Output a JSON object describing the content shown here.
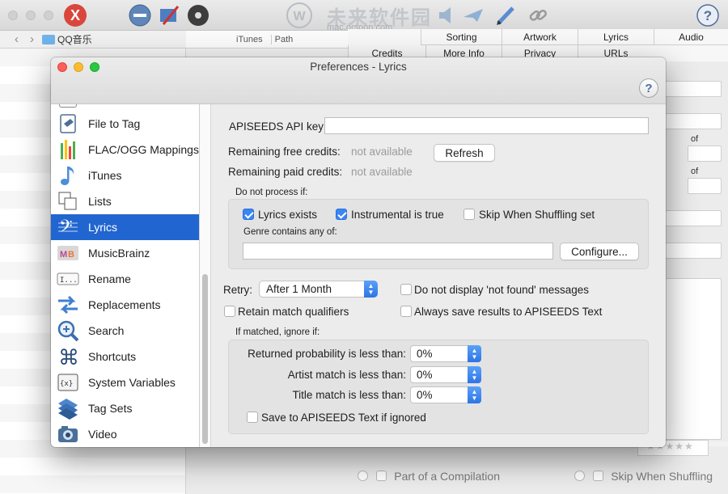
{
  "background": {
    "path_folder": "QQ音乐",
    "columns": [
      "iTunes",
      "Path"
    ],
    "tabs_row1": [
      "Sorting",
      "Artwork",
      "Lyrics",
      "Audio"
    ],
    "tabs_row2": [
      "Credits",
      "More Info",
      "Privacy",
      "URLs"
    ],
    "of_label_1": "of",
    "of_label_2": "of",
    "watermark_cn": "未来软件园",
    "watermark_url": "mac.orsoon.com",
    "bottom_compilation": "Part of a Compilation",
    "bottom_skip": "Skip When Shuffling",
    "rating_stars": "★★★★★"
  },
  "dialog": {
    "title": "Preferences - Lyrics",
    "help": "?"
  },
  "sidebar": {
    "items": [
      {
        "label": "File to Tag",
        "icon": "file-tag-icon"
      },
      {
        "label": "FLAC/OGG Mappings",
        "icon": "flac-ogg-icon"
      },
      {
        "label": "iTunes",
        "icon": "itunes-note-icon"
      },
      {
        "label": "Lists",
        "icon": "lists-icon"
      },
      {
        "label": "Lyrics",
        "icon": "lyrics-clef-icon",
        "selected": true
      },
      {
        "label": "MusicBrainz",
        "icon": "musicbrainz-icon"
      },
      {
        "label": "Rename",
        "icon": "rename-icon"
      },
      {
        "label": "Replacements",
        "icon": "replacements-icon"
      },
      {
        "label": "Search",
        "icon": "search-icon"
      },
      {
        "label": "Shortcuts",
        "icon": "command-key-icon"
      },
      {
        "label": "System Variables",
        "icon": "system-variables-icon"
      },
      {
        "label": "Tag Sets",
        "icon": "tag-sets-icon"
      },
      {
        "label": "Video",
        "icon": "video-camera-icon"
      }
    ]
  },
  "lyrics": {
    "api_key_label": "APISEEDS API key:",
    "api_key_value": "",
    "free_credits_label": "Remaining free credits:",
    "free_credits_value": "not available",
    "paid_credits_label": "Remaining paid credits:",
    "paid_credits_value": "not available",
    "refresh_button": "Refresh",
    "do_not_process_label": "Do not process if:",
    "lyrics_exists": "Lyrics exists",
    "lyrics_exists_checked": true,
    "instrumental": "Instrumental is true",
    "instrumental_checked": true,
    "skip_shuffling": "Skip When Shuffling set",
    "skip_shuffling_checked": false,
    "genre_label": "Genre contains any of:",
    "genre_value": "",
    "configure_button": "Configure...",
    "retry_label": "Retry:",
    "retry_value": "After 1 Month",
    "no_display_not_found": "Do not display 'not found' messages",
    "retain_qualifiers": "Retain match qualifiers",
    "always_save": "Always save results to APISEEDS Text",
    "if_matched_label": "If matched, ignore if:",
    "prob_label": "Returned probability is less than:",
    "prob_value": "0%",
    "artist_label": "Artist match is less than:",
    "artist_value": "0%",
    "title_label": "Title match is less than:",
    "title_value": "0%",
    "save_ignored": "Save to APISEEDS Text if ignored"
  }
}
